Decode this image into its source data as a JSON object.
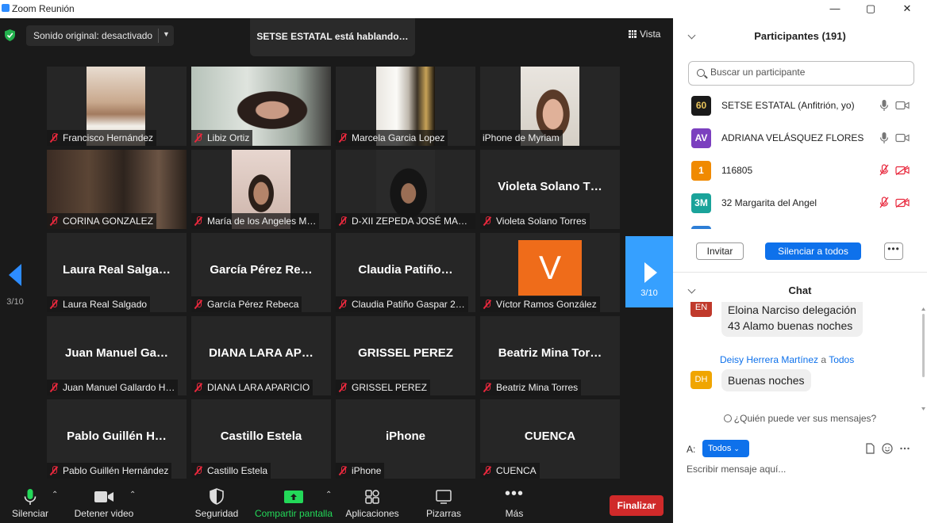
{
  "window": {
    "title": "Zoom Reunión",
    "buttons": [
      "—",
      "▢",
      "✕"
    ]
  },
  "top_bar": {
    "audio_label": "Sonido original: desactivado",
    "speaker_banner": "SETSE ESTATAL está hablando…",
    "view_label": "Vista"
  },
  "gallery": {
    "page_indicator": "3/10",
    "tiles": [
      {
        "caption": "Francisco Hernández",
        "muted": true,
        "video": true
      },
      {
        "caption": "Libiz Ortiz",
        "muted": true,
        "video": true
      },
      {
        "caption": "Marcela Garcia Lopez",
        "muted": true,
        "video": true
      },
      {
        "caption": "iPhone de Myriam",
        "muted": false,
        "video": true
      },
      {
        "caption": "CORINA GONZALEZ",
        "muted": true,
        "video": true
      },
      {
        "caption": "María de los Angeles M…",
        "muted": true,
        "video": true
      },
      {
        "caption": "D-XII ZEPEDA JOSÉ MAR…",
        "muted": true,
        "video": true
      },
      {
        "display": "Violeta Solano T…",
        "caption": "Violeta Solano Torres",
        "muted": true
      },
      {
        "display": "Laura Real Salga…",
        "caption": "Laura Real Salgado",
        "muted": true
      },
      {
        "display": "García Pérez Re…",
        "caption": "García Pérez Rebeca",
        "muted": true
      },
      {
        "display": "Claudia Patiño…",
        "caption": "Claudia Patiño Gaspar 2…",
        "muted": true
      },
      {
        "avatar_letter": "V",
        "caption": "Víctor Ramos González",
        "muted": true
      },
      {
        "display": "Juan Manuel Ga…",
        "caption": "Juan Manuel Gallardo H…",
        "muted": true
      },
      {
        "display": "DIANA LARA AP…",
        "caption": "DIANA LARA APARICIO",
        "muted": true
      },
      {
        "display": "GRISSEL PEREZ",
        "caption": "GRISSEL PEREZ",
        "muted": true
      },
      {
        "display": "Beatriz Mina Tor…",
        "caption": "Beatriz Mina Torres",
        "muted": true
      },
      {
        "display": "Pablo Guillén H…",
        "caption": "Pablo Guillén Hernández",
        "muted": true
      },
      {
        "display": "Castillo Estela",
        "caption": "Castillo Estela",
        "muted": true
      },
      {
        "display": "iPhone",
        "caption": "iPhone",
        "muted": true
      },
      {
        "display": "CUENCA",
        "caption": "CUENCA",
        "muted": true
      }
    ]
  },
  "toolbar": {
    "mute": "Silenciar",
    "stop_video": "Detener video",
    "security": "Seguridad",
    "share_screen": "Compartir pantalla",
    "apps": "Aplicaciones",
    "whiteboards": "Pizarras",
    "more": "Más",
    "end": "Finalizar"
  },
  "participants": {
    "title": "Participantes (191)",
    "search_placeholder": "Buscar un participante",
    "list": [
      {
        "initials": "60",
        "name": "SETSE ESTATAL (Anfitrión, yo)",
        "color": "#1a1a1a",
        "muted": false
      },
      {
        "initials": "AV",
        "name": "ADRIANA VELÁSQUEZ FLORES",
        "color": "#7b3fbf",
        "muted": false
      },
      {
        "initials": "1",
        "name": "116805",
        "color": "#f08a00",
        "muted": true
      },
      {
        "initials": "3M",
        "name": "32 Margarita del Angel",
        "color": "#1aa39a",
        "muted": true
      }
    ],
    "invite": "Invitar",
    "mute_all": "Silenciar a todos",
    "more": "•••"
  },
  "chat": {
    "title": "Chat",
    "messages": [
      {
        "initials": "EN",
        "color": "#c0392b",
        "text_line1": "Eloina Narciso delegación",
        "text_line2": "43 Alamo buenas noches"
      },
      {
        "initials": "DH",
        "color": "#f0a500",
        "sender": "Deisy Herrera Martínez",
        "to_word": "a",
        "recipient": "Todos",
        "text": "Buenas noches"
      }
    ],
    "who_can_see": "¿Quién puede ver sus mensajes?",
    "to_label": "A:",
    "to_value": "Todos",
    "input_placeholder": "Escribir mensaje aquí..."
  },
  "colors": {
    "accent": "#0e71eb",
    "end_button": "#d02a2a",
    "muted_red": "#e8283d",
    "share_green": "#23d959"
  }
}
